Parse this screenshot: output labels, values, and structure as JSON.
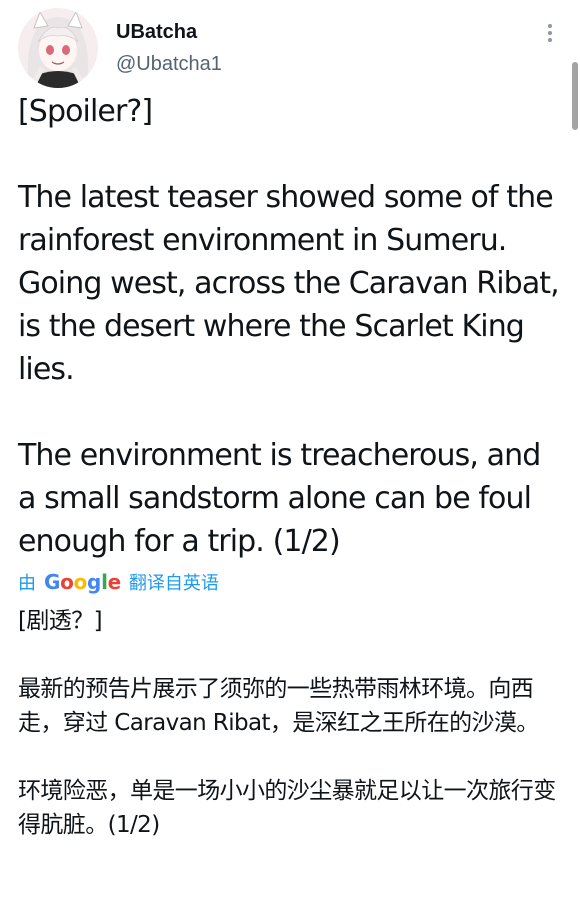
{
  "author": {
    "display_name": "UBatcha",
    "handle": "@Ubatcha1"
  },
  "icons": {
    "avatar": "avatar-image",
    "more": "more-options-icon"
  },
  "tweet": {
    "text": "[Spoiler?]\n\nThe latest teaser showed some of the rainforest environment in Sumeru.\nGoing west, across the Caravan Ribat, is the desert where the Scarlet King lies.\n\nThe environment is treacherous, and a small sandstorm alone can be foul enough for a trip. (1/2)"
  },
  "translation": {
    "prefix": "由",
    "provider_letters": [
      "G",
      "o",
      "o",
      "g",
      "l",
      "e"
    ],
    "suffix": "翻译自英语",
    "text": "[剧透？]\n\n最新的预告片展示了须弥的一些热带雨林环境。向西走，穿过 Caravan Ribat，是深红之王所在的沙漠。\n\n环境险恶，单是一场小小的沙尘暴就足以让一次旅行变得肮脏。(1/2)"
  },
  "colors": {
    "link": "#1d9bf0",
    "secondary_text": "#536471",
    "primary_text": "#0f1419"
  }
}
